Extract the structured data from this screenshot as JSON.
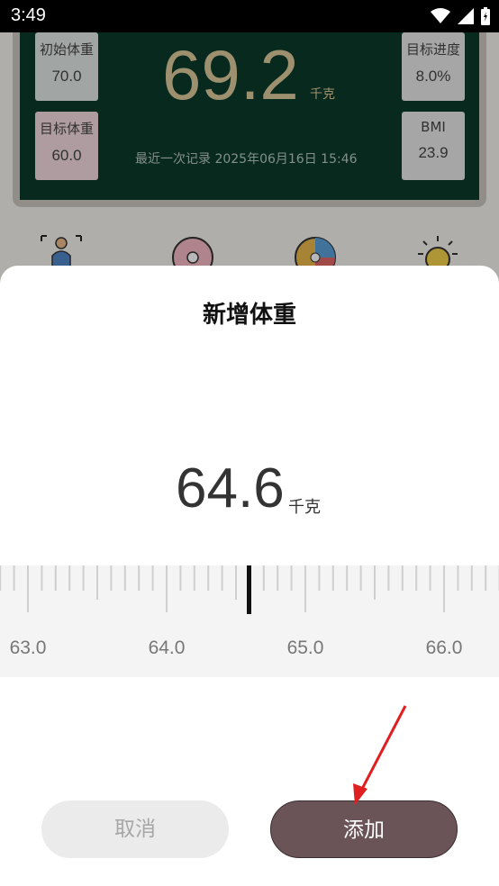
{
  "status_bar": {
    "time": "3:49"
  },
  "dashboard": {
    "initial_weight": {
      "label": "初始体重",
      "value": "70.0"
    },
    "target_weight": {
      "label": "目标体重",
      "value": "60.0"
    },
    "target_progress": {
      "label": "目标进度",
      "value": "8.0%"
    },
    "bmi": {
      "label": "BMI",
      "value": "23.9"
    },
    "current_weight": "69.2",
    "unit": "千克",
    "last_record": "最近一次记录 2025年06月16日 15:46"
  },
  "dialog": {
    "title": "新增体重",
    "value": "64.6",
    "unit": "千克",
    "ruler_labels": [
      "63.0",
      "64.0",
      "65.0",
      "66.0"
    ],
    "cancel_label": "取消",
    "add_label": "添加"
  },
  "colors": {
    "dashboard_bg": "#0b3a2a",
    "big_number": "#d8c89a",
    "add_button": "#6a5458",
    "annotation_arrow": "#e02020"
  }
}
